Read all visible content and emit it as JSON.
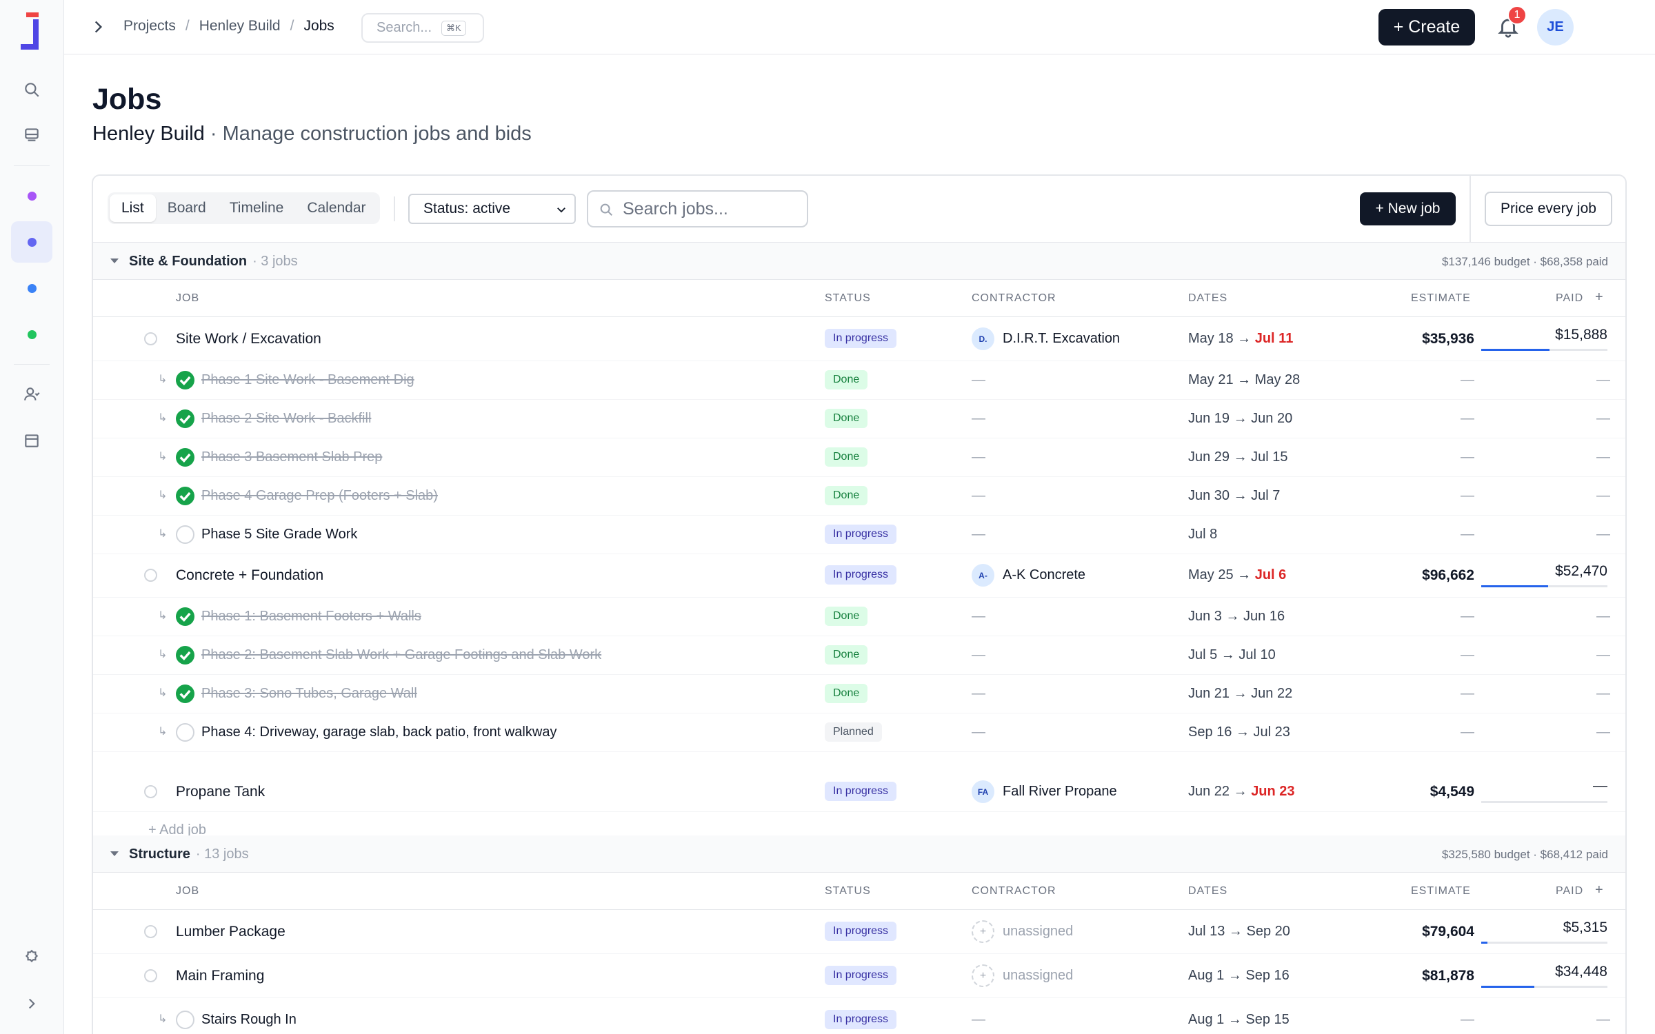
{
  "sidebar": {
    "items": [
      {
        "name": "search-icon"
      },
      {
        "name": "inbox-icon"
      },
      {
        "name": "project-dot-purple",
        "color": "#a855f7"
      },
      {
        "name": "project-dot-indigo",
        "color": "#6366f1"
      },
      {
        "name": "project-dot-blue",
        "color": "#3b82f6"
      },
      {
        "name": "project-dot-green",
        "color": "#22c55e"
      },
      {
        "name": "people-icon"
      },
      {
        "name": "calendar-icon"
      },
      {
        "name": "settings-icon"
      },
      {
        "name": "expand-icon"
      }
    ]
  },
  "topbar": {
    "breadcrumb": [
      "Projects",
      "Henley Build",
      "Jobs"
    ],
    "search_placeholder": "Search...",
    "search_shortcut": "⌘K",
    "create_label": "+ Create",
    "notifications_count": "1",
    "avatar_initials": "JE"
  },
  "header": {
    "title": "Jobs",
    "project": "Henley Build",
    "subtitle": " · Manage construction jobs and bids"
  },
  "toolbar": {
    "views": [
      "List",
      "Board",
      "Timeline",
      "Calendar"
    ],
    "active_view": "List",
    "status_filter": "Status: active",
    "search_placeholder": "Search jobs...",
    "new_job_label": "+ New job",
    "price_label": "Price every job"
  },
  "columns": {
    "job": "JOB",
    "status": "STATUS",
    "contractor": "CONTRACTOR",
    "dates": "DATES",
    "estimate": "ESTIMATE",
    "paid": "PAID",
    "add": "+"
  },
  "groups": [
    {
      "name": "Site & Foundation",
      "count": "· 3 jobs",
      "summary": "$137,146 budget · $68,358 paid",
      "add_label": "+ Add job",
      "jobs": [
        {
          "name": "Site Work / Excavation",
          "status": "In progress",
          "contractor_initials": "D.",
          "contractor": "D.I.R.T. Excavation",
          "date_start": "May 18",
          "date_end": "Jul 11",
          "estimate": "$35,936",
          "paid": "$15,888",
          "paid_fraction": 0.54,
          "subs": [
            {
              "name": "Phase 1 Site Work - Basement Dig",
              "status": "Done",
              "contractor": "—",
              "dates": "May 21 → May 28",
              "estimate": "—",
              "paid": "—"
            },
            {
              "name": "Phase 2 Site Work - Backfill",
              "status": "Done",
              "contractor": "—",
              "dates": "Jun 19 → Jun 20",
              "estimate": "—",
              "paid": "—"
            },
            {
              "name": "Phase 3 Basement Slab Prep",
              "status": "Done",
              "contractor": "—",
              "dates": "Jun 29 → Jul 15",
              "estimate": "—",
              "paid": "—"
            },
            {
              "name": "Phase 4 Garage Prep (Footers + Slab)",
              "status": "Done",
              "contractor": "—",
              "dates": "Jun 30 → Jul 7",
              "estimate": "—",
              "paid": "—"
            },
            {
              "name": "Phase 5 Site Grade Work",
              "status": "In progress",
              "contractor": "—",
              "dates": "Jul 8",
              "estimate": "—",
              "paid": "—"
            }
          ]
        },
        {
          "name": "Concrete + Foundation",
          "status": "In progress",
          "contractor_initials": "A-",
          "contractor": "A-K Concrete",
          "date_start": "May 25",
          "date_end": "Jul 6",
          "estimate": "$96,662",
          "paid": "$52,470",
          "paid_fraction": 0.53,
          "subs": [
            {
              "name": "Phase 1: Basement Footers + Walls",
              "status": "Done",
              "contractor": "—",
              "dates": "Jun 3 → Jun 16",
              "estimate": "—",
              "paid": "—"
            },
            {
              "name": "Phase 2: Basement Slab Work + Garage Footings and Slab Work",
              "status": "Done",
              "contractor": "—",
              "dates": "Jul 5 → Jul 10",
              "estimate": "—",
              "paid": "—"
            },
            {
              "name": "Phase 3: Sono Tubes, Garage Wall",
              "status": "Done",
              "contractor": "—",
              "dates": "Jun 21 → Jun 22",
              "estimate": "—",
              "paid": "—"
            },
            {
              "name": "Phase 4: Driveway, garage slab, back patio, front walkway",
              "status": "Planned",
              "contractor": "—",
              "dates": "Sep 16 → Jul 23",
              "estimate": "—",
              "paid": "—"
            }
          ]
        },
        {
          "name": "Propane Tank",
          "status": "In progress",
          "contractor_initials": "FA",
          "contractor": "Fall River Propane",
          "date_start": "Jun 22",
          "date_end": "Jun 23",
          "estimate": "$4,549",
          "paid": "—",
          "paid_fraction": 0,
          "subs": []
        }
      ]
    },
    {
      "name": "Structure",
      "count": "· 13 jobs",
      "summary": "$325,580 budget · $68,412 paid",
      "jobs": [
        {
          "name": "Lumber Package",
          "status": "In progress",
          "contractor_initials": "+",
          "contractor": "unassigned",
          "date_start": "Jul 13",
          "date_end": "Sep 20",
          "estimate": "$79,604",
          "paid": "$5,315",
          "paid_fraction": 0.05,
          "subs": []
        },
        {
          "name": "Main Framing",
          "status": "In progress",
          "contractor_initials": "+",
          "contractor": "unassigned",
          "date_start": "Aug 1",
          "date_end": "Sep 16",
          "estimate": "$81,878",
          "paid": "$34,448",
          "paid_fraction": 0.42,
          "subs": [
            {
              "name": "Stairs Rough In",
              "status": "In progress",
              "contractor": "—",
              "dates": "Aug 1 → Sep 15",
              "estimate": "—",
              "paid": "—"
            }
          ]
        }
      ]
    }
  ],
  "colors": {
    "accent": "#111827",
    "progress_bar": "#2563eb",
    "overdue": "#dc2626",
    "done_check": "#16a34a"
  }
}
